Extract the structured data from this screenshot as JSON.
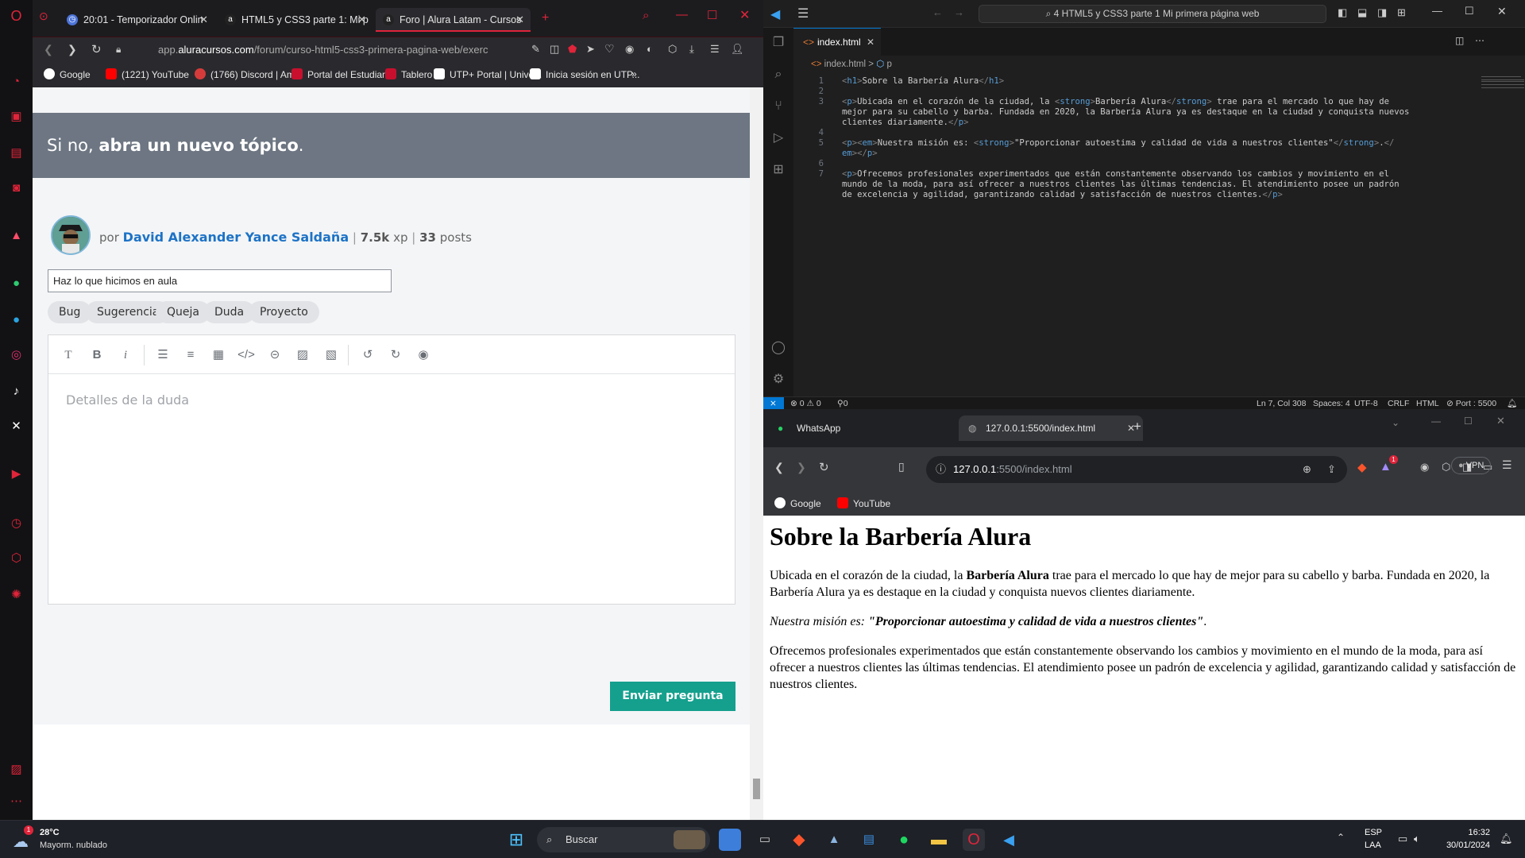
{
  "opera": {
    "tabs": [
      {
        "label": "20:01 - Temporizador Onlin"
      },
      {
        "label": "HTML5 y CSS3 parte 1: Mi p"
      },
      {
        "label": "Foro | Alura Latam - Cursos"
      }
    ],
    "url_domain_prefix": "app.",
    "url_domain": "aluracursos.com",
    "url_path": "/forum/curso-html5-css3-primera-pagina-web/exerc",
    "bookmarks": [
      {
        "label": "Google",
        "icon": "google-icon"
      },
      {
        "label": "(1221) YouTube",
        "icon": "youtube-icon"
      },
      {
        "label": "(1766) Discord | Am...",
        "icon": "discord-icon"
      },
      {
        "label": "Portal del Estudiante",
        "icon": "utp-icon"
      },
      {
        "label": "Tablero",
        "icon": "utp-icon"
      },
      {
        "label": "UTP+ Portal | Unive...",
        "icon": "utp-portal-icon"
      },
      {
        "label": "Inicia sesión en UTP...",
        "icon": "utp-portal-icon"
      }
    ],
    "page": {
      "banner_prefix": "Si no, ",
      "banner_bold": "abra un nuevo tópico",
      "banner_suffix": ".",
      "author_prefix": "por",
      "author_name": "David Alexander Yance Saldaña",
      "author_xp": "7.5k",
      "author_xp_unit": "xp",
      "author_posts": "33",
      "author_posts_unit": "posts",
      "title_value": "Haz lo que hicimos en aula",
      "tags": [
        "Bug",
        "Sugerencia",
        "Queja",
        "Duda",
        "Proyecto"
      ],
      "editor_placeholder": "Detalles de la duda",
      "send_label": "Enviar pregunta"
    }
  },
  "vscode": {
    "search": "4 HTML5 y CSS3 parte 1 Mi primera página web",
    "tab": "index.html",
    "breadcrumb_file": "index.html",
    "breadcrumb_sep": ">",
    "breadcrumb_element": "p",
    "lines": [
      {
        "n": "1",
        "parts": [
          [
            "tg",
            "<"
          ],
          [
            "tn",
            "h1"
          ],
          [
            "tg",
            ">"
          ],
          [
            "tx",
            "Sobre la Barbería Alura"
          ],
          [
            "tg",
            "</"
          ],
          [
            "tn",
            "h1"
          ],
          [
            "tg",
            ">"
          ]
        ]
      },
      {
        "n": "2",
        "parts": []
      },
      {
        "n": "3",
        "parts": [
          [
            "tg",
            "<"
          ],
          [
            "tn",
            "p"
          ],
          [
            "tg",
            ">"
          ],
          [
            "tx",
            "Ubicada en el corazón de la ciudad, la "
          ],
          [
            "tg",
            "<"
          ],
          [
            "tn",
            "strong"
          ],
          [
            "tg",
            ">"
          ],
          [
            "tx",
            "Barbería Alura"
          ],
          [
            "tg",
            "</"
          ],
          [
            "tn",
            "strong"
          ],
          [
            "tg",
            ">"
          ],
          [
            "tx",
            " trae para el mercado lo que hay de"
          ]
        ]
      },
      {
        "n": "",
        "parts": [
          [
            "tx",
            "mejor para su cabello y barba. Fundada en 2020, la Barbería Alura ya es destaque en la ciudad y conquista nuevos"
          ]
        ]
      },
      {
        "n": "",
        "parts": [
          [
            "tx",
            "clientes diariamente."
          ],
          [
            "tg",
            "</"
          ],
          [
            "tn",
            "p"
          ],
          [
            "tg",
            ">"
          ]
        ]
      },
      {
        "n": "4",
        "parts": []
      },
      {
        "n": "5",
        "parts": [
          [
            "tg",
            "<"
          ],
          [
            "tn",
            "p"
          ],
          [
            "tg",
            "><"
          ],
          [
            "tn",
            "em"
          ],
          [
            "tg",
            ">"
          ],
          [
            "tx",
            "Nuestra misión es: "
          ],
          [
            "tg",
            "<"
          ],
          [
            "tn",
            "strong"
          ],
          [
            "tg",
            ">"
          ],
          [
            "tx",
            "\"Proporcionar autoestima y calidad de vida a nuestros clientes\""
          ],
          [
            "tg",
            "</"
          ],
          [
            "tn",
            "strong"
          ],
          [
            "tg",
            ">"
          ],
          [
            "tx",
            "."
          ],
          [
            "tg",
            "</"
          ]
        ]
      },
      {
        "n": "",
        "parts": [
          [
            "tn",
            "em"
          ],
          [
            "tg",
            "></"
          ],
          [
            "tn",
            "p"
          ],
          [
            "tg",
            ">"
          ]
        ]
      },
      {
        "n": "6",
        "parts": []
      },
      {
        "n": "7",
        "parts": [
          [
            "tg",
            "<"
          ],
          [
            "tn",
            "p"
          ],
          [
            "tg",
            ">"
          ],
          [
            "tx",
            "Ofrecemos profesionales experimentados que están constantemente observando los cambios y movimiento en el"
          ]
        ]
      },
      {
        "n": "",
        "parts": [
          [
            "tx",
            "mundo de la moda, para así ofrecer a nuestros clientes las últimas tendencias. El atendimiento posee un padrón"
          ]
        ]
      },
      {
        "n": "",
        "parts": [
          [
            "tx",
            "de excelencia y agilidad, garantizando calidad y satisfacción de nuestros clientes."
          ],
          [
            "tg",
            "</"
          ],
          [
            "tn",
            "p"
          ],
          [
            "tg",
            ">"
          ]
        ]
      }
    ],
    "status": {
      "errors": "0",
      "warnings": "0",
      "ports": "0",
      "position": "Ln 7, Col 308",
      "spaces": "Spaces: 4",
      "encoding": "UTF-8",
      "eol": "CRLF",
      "language": "HTML",
      "port": "Port : 5500"
    }
  },
  "brave": {
    "tabs": [
      {
        "label": "WhatsApp"
      },
      {
        "label": "127.0.0.1:5500/index.html"
      }
    ],
    "url_host": "127.0.0.1",
    "url_rest": ":5500/index.html",
    "badge_count": "1",
    "vpn_label": "VPN",
    "bookmarks": [
      {
        "label": "Google"
      },
      {
        "label": "YouTube"
      }
    ],
    "page": {
      "h1": "Sobre la Barbería Alura",
      "p1_a": "Ubicada en el corazón de la ciudad, la ",
      "p1_strong": "Barbería Alura",
      "p1_b": " trae para el mercado lo que hay de mejor para su cabello y barba. Fundada en 2020, la Barbería Alura ya es destaque en la ciudad y conquista nuevos clientes diariamente.",
      "p2_em": "Nuestra misión es: ",
      "p2_strong": "\"Proporcionar autoestima y calidad de vida a nuestros clientes\"",
      "p2_end": ".",
      "p3": "Ofrecemos profesionales experimentados que están constantemente observando los cambios y movimiento en el mundo de la moda, para así ofrecer a nuestros clientes las últimas tendencias. El atendimiento posee un padrón de excelencia y agilidad, garantizando calidad y satisfacción de nuestros clientes."
    }
  },
  "taskbar": {
    "weather_temp": "28°C",
    "weather_desc": "Mayorm. nublado",
    "weather_badge": "1",
    "search_label": "Buscar",
    "lang_top": "ESP",
    "lang_bottom": "LAA",
    "time": "16:32",
    "date": "30/01/2024"
  },
  "colors": {
    "opera_accent": "#e0243a",
    "banner_bg": "#6d7682",
    "send_button": "#14a08d",
    "author_link": "#1d73c6",
    "vscode_blue": "#0078d4"
  }
}
